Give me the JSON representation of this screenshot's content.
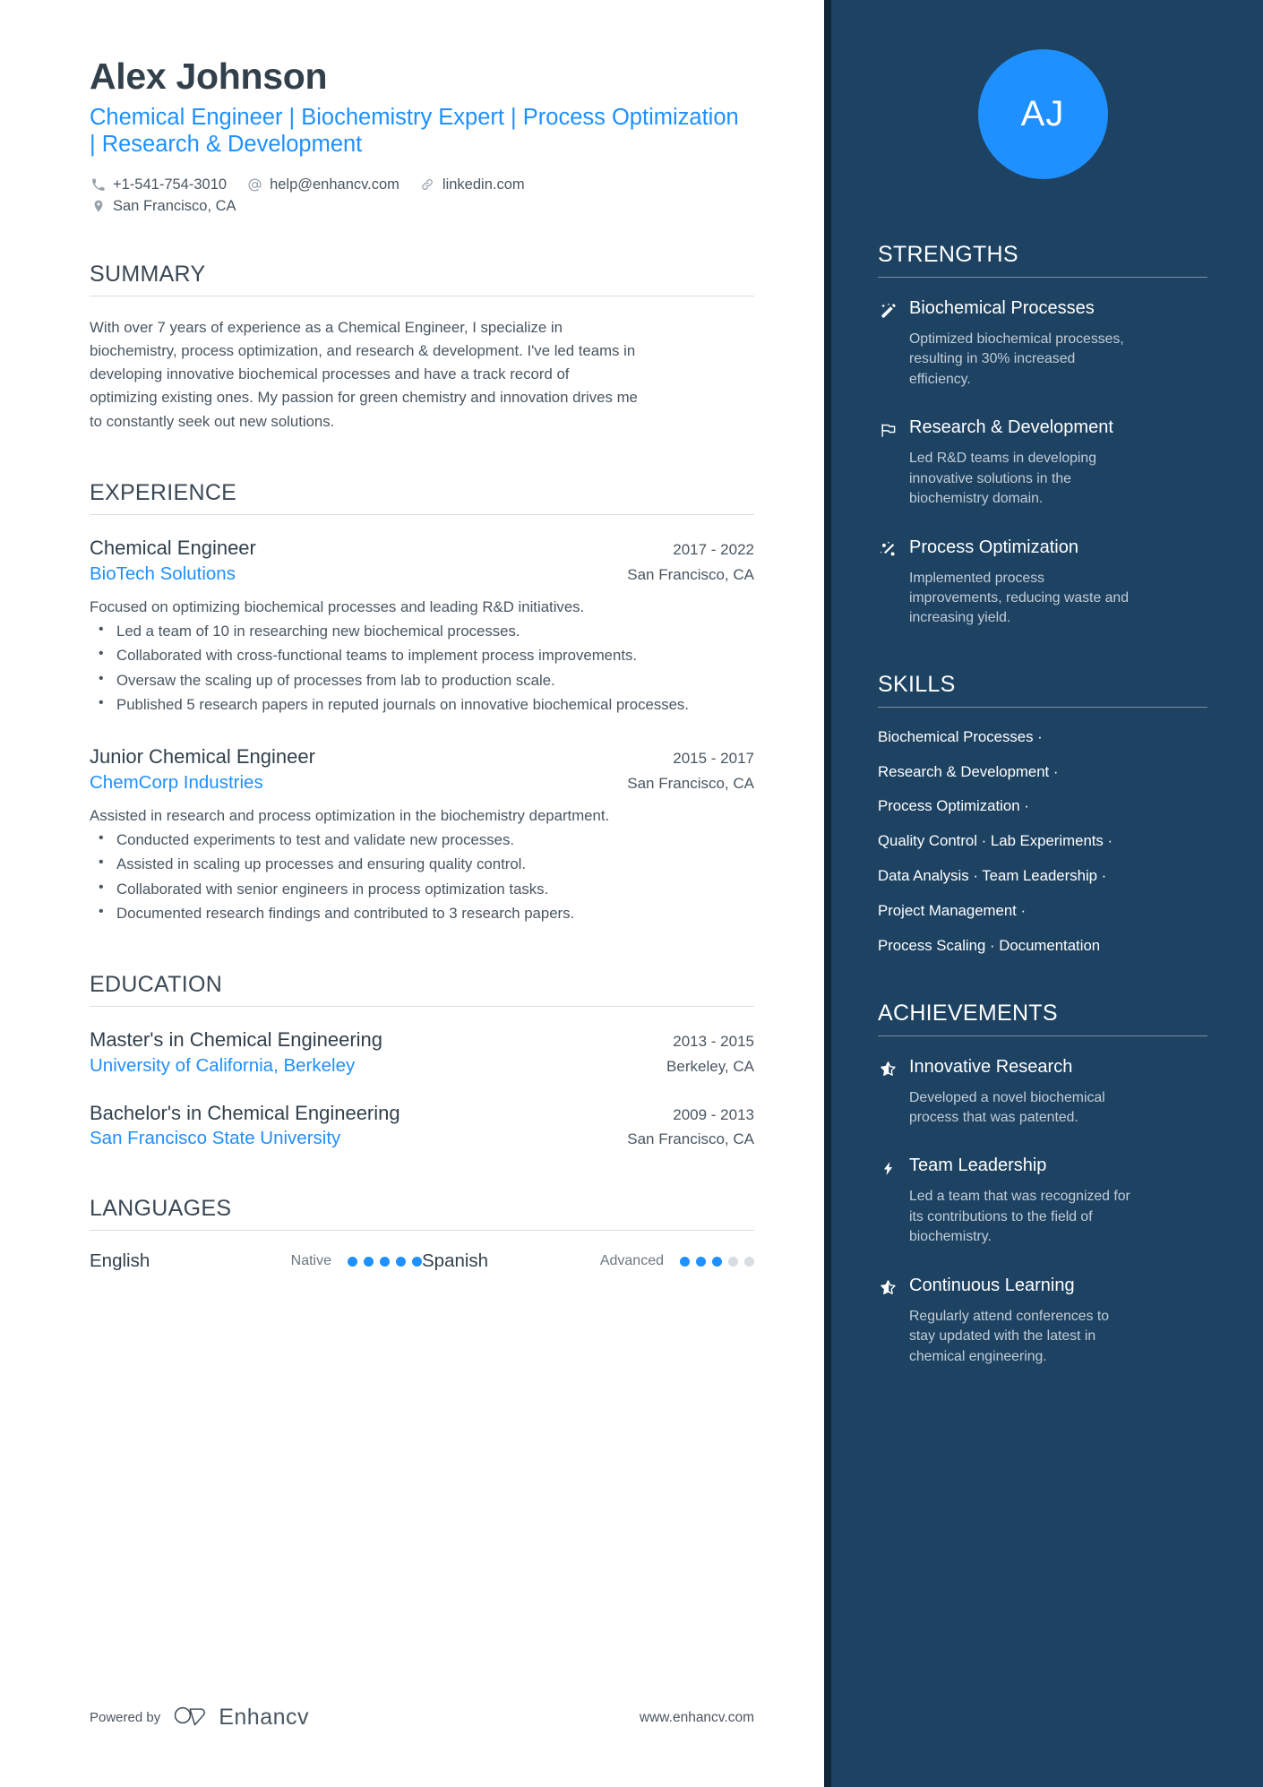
{
  "header": {
    "name": "Alex Johnson",
    "headline": "Chemical Engineer | Biochemistry Expert | Process Optimization | Research & Development",
    "initials": "AJ",
    "contacts": [
      {
        "icon": "phone-icon",
        "text": "+1-541-754-3010"
      },
      {
        "icon": "at-email-icon",
        "text": "help@enhancv.com"
      },
      {
        "icon": "link-icon",
        "text": "linkedin.com"
      },
      {
        "icon": "location-pin-icon",
        "text": "San Francisco, CA"
      }
    ]
  },
  "summary": {
    "title": "SUMMARY",
    "text": "With over 7 years of experience as a Chemical Engineer, I specialize in biochemistry, process optimization, and research & development. I've led teams in developing innovative biochemical processes and have a track record of optimizing existing ones. My passion for green chemistry and innovation drives me to constantly seek out new solutions."
  },
  "experience": {
    "title": "EXPERIENCE",
    "entries": [
      {
        "role": "Chemical Engineer",
        "date": "2017 - 2022",
        "company": "BioTech Solutions",
        "location": "San Francisco, CA",
        "description": "Focused on optimizing biochemical processes and leading R&D initiatives.",
        "bullets": [
          "Led a team of 10 in researching new biochemical processes.",
          "Collaborated with cross-functional teams to implement process improvements.",
          "Oversaw the scaling up of processes from lab to production scale.",
          "Published 5 research papers in reputed journals on innovative biochemical processes."
        ]
      },
      {
        "role": "Junior Chemical Engineer",
        "date": "2015 - 2017",
        "company": "ChemCorp Industries",
        "location": "San Francisco, CA",
        "description": "Assisted in research and process optimization in the biochemistry department.",
        "bullets": [
          "Conducted experiments to test and validate new processes.",
          "Assisted in scaling up processes and ensuring quality control.",
          "Collaborated with senior engineers in process optimization tasks.",
          "Documented research findings and contributed to 3 research papers."
        ]
      }
    ]
  },
  "education": {
    "title": "EDUCATION",
    "entries": [
      {
        "degree": "Master's in Chemical Engineering",
        "date": "2013 - 2015",
        "school": "University of California, Berkeley",
        "location": "Berkeley, CA"
      },
      {
        "degree": "Bachelor's in Chemical Engineering",
        "date": "2009 - 2013",
        "school": "San Francisco State University",
        "location": "San Francisco, CA"
      }
    ]
  },
  "languages": {
    "title": "LANGUAGES",
    "items": [
      {
        "name": "English",
        "level": "Native",
        "filled": 5,
        "total": 5
      },
      {
        "name": "Spanish",
        "level": "Advanced",
        "filled": 3,
        "total": 5
      }
    ]
  },
  "strengths": {
    "title": "STRENGTHS",
    "items": [
      {
        "icon": "magic-wand-icon",
        "name": "Biochemical Processes",
        "description": "Optimized biochemical processes, resulting in 30% increased efficiency."
      },
      {
        "icon": "flag-icon",
        "name": "Research & Development",
        "description": "Led R&D teams in developing innovative solutions in the biochemistry domain."
      },
      {
        "icon": "sparkle-percent-icon",
        "name": "Process Optimization",
        "description": "Implemented process improvements, reducing waste and increasing yield."
      }
    ]
  },
  "skills": {
    "title": "SKILLS",
    "lines": [
      "Biochemical Processes ·",
      "Research & Development ·",
      "Process Optimization ·",
      "Quality Control · Lab Experiments ·",
      "Data Analysis · Team Leadership ·",
      "Project Management ·",
      "Process Scaling · Documentation"
    ]
  },
  "achievements": {
    "title": "ACHIEVEMENTS",
    "items": [
      {
        "icon": "star-icon",
        "name": "Innovative Research",
        "description": "Developed a novel biochemical process that was patented."
      },
      {
        "icon": "lightning-bolt-icon",
        "name": "Team Leadership",
        "description": "Led a team that was recognized for its contributions to the field of biochemistry."
      },
      {
        "icon": "star-icon",
        "name": "Continuous Learning",
        "description": "Regularly attend conferences to stay updated with the latest in chemical engineering."
      }
    ]
  },
  "footer": {
    "powered_by": "Powered by",
    "brand": "Enhancv",
    "website": "www.enhancv.com"
  },
  "colors": {
    "accent_blue": "#1e90ff",
    "sidebar_navy": "#1d4262",
    "sidebar_edge": "#12263a",
    "text_dark": "#32404c",
    "text_body": "#4a5661"
  }
}
